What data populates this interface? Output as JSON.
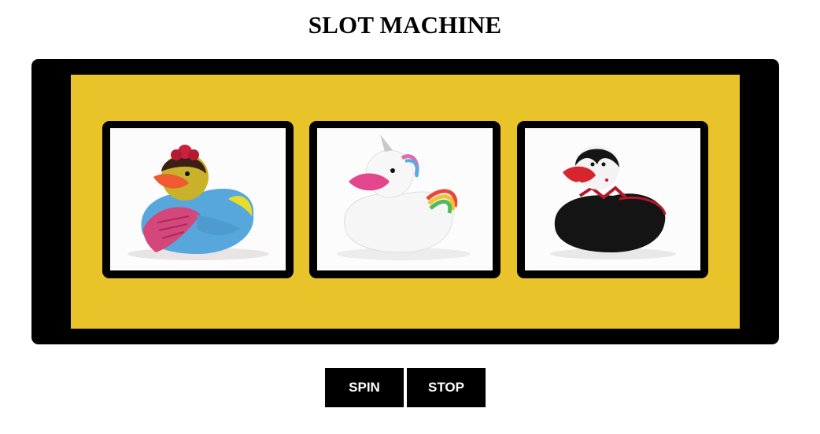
{
  "title": "SLOT MACHINE",
  "colors": {
    "machine_frame": "#000000",
    "panel": "#E8C42A",
    "button_bg": "#000000",
    "button_text": "#FFFFFF"
  },
  "reels": [
    {
      "icon": "frida-duck-icon"
    },
    {
      "icon": "unicorn-duck-icon"
    },
    {
      "icon": "vampire-duck-icon"
    }
  ],
  "buttons": {
    "spin_label": "SPIN",
    "stop_label": "STOP"
  }
}
